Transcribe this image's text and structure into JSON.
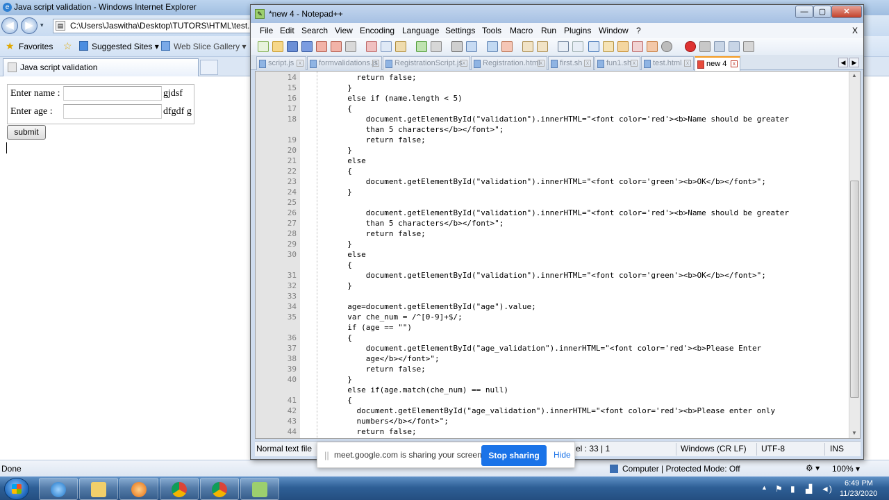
{
  "browser": {
    "title": "Java script validation - Windows Internet Explorer",
    "address": "C:\\Users\\Jaswitha\\Desktop\\TUTORS\\HTML\\test.htm",
    "favorites_label": "Favorites",
    "suggested_sites": "Suggested Sites ▾",
    "web_slice": "Web Slice Gallery ▾",
    "tab_label": "Java script validation",
    "status_left": "Done",
    "status_zone": "Computer | Protected Mode: Off",
    "zoom": "100% ▾"
  },
  "form": {
    "name_label": "Enter name :",
    "name_value": "",
    "name_message": "gjdsf",
    "age_label": "Enter age :",
    "age_value": "",
    "age_message": "dfgdf g",
    "submit_label": "submit"
  },
  "notepad": {
    "title": "*new 4 - Notepad++",
    "window_buttons": [
      "—",
      "▢",
      "✕"
    ],
    "menu": [
      "File",
      "Edit",
      "Search",
      "View",
      "Encoding",
      "Language",
      "Settings",
      "Tools",
      "Macro",
      "Run",
      "Plugins",
      "Window",
      "?"
    ],
    "menu_close": "X",
    "tabs": [
      "script.js",
      "formvalidations.js",
      "RegistrationScript.js",
      "Registration.html",
      "first.sh",
      "fun1.sh",
      "test.html",
      "new 4"
    ],
    "active_tab": "new 4",
    "lines": [
      {
        "n": "14",
        "code": "            return false;"
      },
      {
        "n": "15",
        "code": "          }"
      },
      {
        "n": "16",
        "code": "          else if (name.length < 5)"
      },
      {
        "n": "17",
        "code": "          {"
      },
      {
        "n": "18",
        "code": "              document.getElementById(\"validation\").innerHTML=\"<font color='red'><b>Name should be greater"
      },
      {
        "n": "",
        "code": "              than 5 characters</b></font>\";"
      },
      {
        "n": "19",
        "code": "              return false;"
      },
      {
        "n": "20",
        "code": "          }"
      },
      {
        "n": "21",
        "code": "          else"
      },
      {
        "n": "22",
        "code": "          {"
      },
      {
        "n": "23",
        "code": "              document.getElementById(\"validation\").innerHTML=\"<font color='green'><b>OK</b></font>\";"
      },
      {
        "n": "24",
        "code": "          }"
      },
      {
        "n": "25",
        "code": ""
      },
      {
        "n": "26",
        "code": "              document.getElementById(\"validation\").innerHTML=\"<font color='red'><b>Name should be greater"
      },
      {
        "n": "27",
        "code": "              than 5 characters</b></font>\";"
      },
      {
        "n": "28",
        "code": "              return false;"
      },
      {
        "n": "29",
        "code": "          }"
      },
      {
        "n": "30",
        "code": "          else"
      },
      {
        "n": "",
        "code": "          {"
      },
      {
        "n": "31",
        "code": "              document.getElementById(\"validation\").innerHTML=\"<font color='green'><b>OK</b></font>\";"
      },
      {
        "n": "32",
        "code": "          }"
      },
      {
        "n": "33",
        "code": ""
      },
      {
        "n": "34",
        "code": "          age=document.getElementById(\"age\").value;"
      },
      {
        "n": "35",
        "code": "          var che_num = /^[0-9]+$/;"
      },
      {
        "n": "",
        "code": "          if (age == \"\")"
      },
      {
        "n": "36",
        "code": "          {"
      },
      {
        "n": "37",
        "code": "              document.getElementById(\"age_validation\").innerHTML=\"<font color='red'><b>Please Enter"
      },
      {
        "n": "38",
        "code": "              age</b></font>\";"
      },
      {
        "n": "39",
        "code": "              return false;"
      },
      {
        "n": "40",
        "code": "          }"
      },
      {
        "n": "",
        "code": "          else if(age.match(che_num) == null)"
      },
      {
        "n": "41",
        "code": "          {"
      },
      {
        "n": "42",
        "code": "            document.getElementById(\"age_validation\").innerHTML=\"<font color='red'><b>Please enter only"
      },
      {
        "n": "43",
        "code": "            numbers</b></font>\";"
      },
      {
        "n": "44",
        "code": "            return false;"
      }
    ],
    "status": {
      "file_type": "Normal text file",
      "position": "el : 33 | 1",
      "eol": "Windows (CR LF)",
      "encoding": "UTF-8",
      "mode": "INS"
    }
  },
  "share_bar": {
    "message": "meet.google.com is sharing your screen.",
    "stop_label": "Stop sharing",
    "hide_label": "Hide",
    "stop_color": "#1a73e8"
  },
  "taskbar": {
    "apps": [
      "internet-explorer-icon",
      "file-explorer-icon",
      "media-player-icon",
      "chrome-icon",
      "chrome-icon",
      "notepad-plus-plus-icon"
    ],
    "time": "6:49 PM",
    "date": "11/23/2020"
  }
}
